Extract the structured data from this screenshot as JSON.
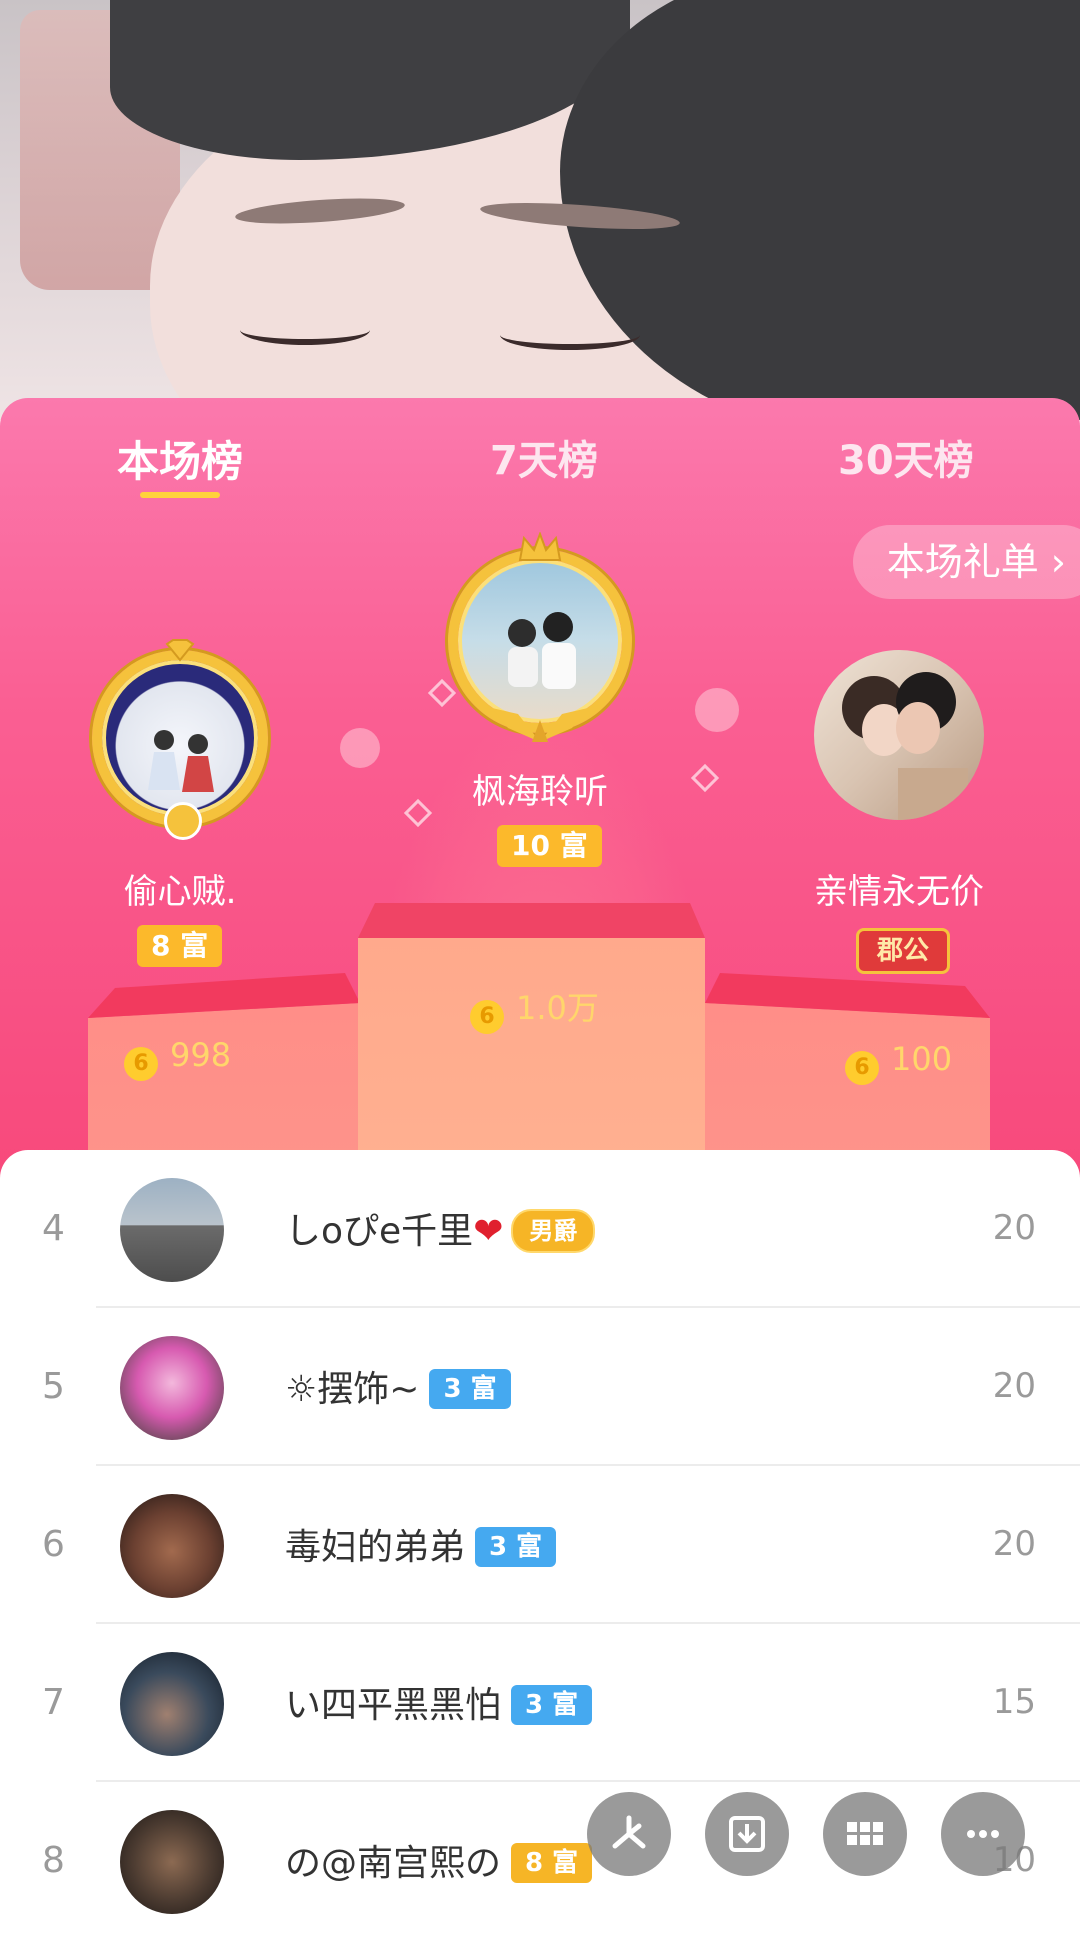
{
  "tabs": [
    {
      "label": "本场榜",
      "active": true
    },
    {
      "label": "7天榜",
      "active": false
    },
    {
      "label": "30天榜",
      "active": false
    }
  ],
  "gift_list_label": "本场礼单 ›",
  "podium": {
    "first": {
      "rank": "1",
      "name": "枫海聆听",
      "level": "10 富",
      "coins": "1.0万"
    },
    "second": {
      "rank": "2",
      "name": "偷心贼.",
      "level": "8 富",
      "coins": "998"
    },
    "third": {
      "rank": "3",
      "name": "亲情永无价",
      "badge": "郡公",
      "coins": "100"
    }
  },
  "coin_glyph": "6",
  "list": [
    {
      "rank": "4",
      "name": "しoぴe千里",
      "badge": "男爵",
      "score": "20"
    },
    {
      "rank": "5",
      "name": "☼摆饰~",
      "badge": "3 富",
      "score": "20"
    },
    {
      "rank": "6",
      "name": "毒妇的弟弟",
      "badge": "3 富",
      "score": "20"
    },
    {
      "rank": "7",
      "name": "い四平黑黑怕",
      "badge": "3 富",
      "score": "15"
    },
    {
      "rank": "8",
      "name": "の@南宫熙の",
      "badge": "8 富",
      "score": "10"
    }
  ],
  "heart_glyph": "❤",
  "colors": {
    "panel_pink": "#f84d80",
    "tab_underline": "#ffd23c",
    "level_gold": "#fcb92b",
    "level_blue": "#45a9f0"
  }
}
